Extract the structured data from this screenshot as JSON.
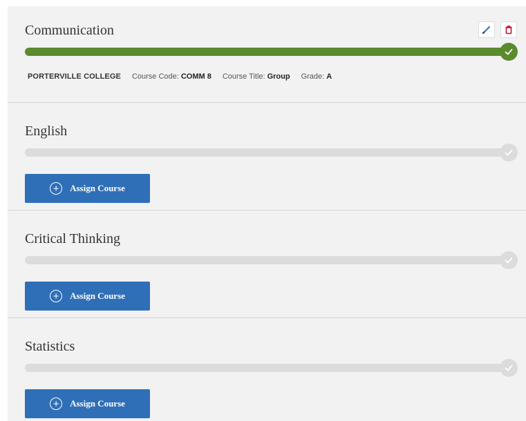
{
  "requirements": [
    {
      "title": "Communication",
      "progress_fraction": 1.0,
      "completed": true,
      "actions": {
        "edit_icon": "pencil-icon",
        "delete_icon": "trash-icon"
      },
      "course": {
        "school": "PORTERVILLE COLLEGE",
        "code_label": "Course Code:",
        "code": "COMM 8",
        "title_label": "Course Title:",
        "title": "Group",
        "grade_label": "Grade:",
        "grade": "A"
      }
    },
    {
      "title": "English",
      "progress_fraction": 0,
      "completed": false,
      "assign_label": "Assign Course"
    },
    {
      "title": "Critical Thinking",
      "progress_fraction": 0,
      "completed": false,
      "assign_label": "Assign Course"
    },
    {
      "title": "Statistics",
      "progress_fraction": 0,
      "completed": false,
      "assign_label": "Assign Course"
    }
  ],
  "colors": {
    "complete": "#5b8a2f",
    "incomplete": "#dcdcdc",
    "primary_button": "#2f6fb7",
    "delete": "#c8102e",
    "edit": "#2f6fb7"
  }
}
